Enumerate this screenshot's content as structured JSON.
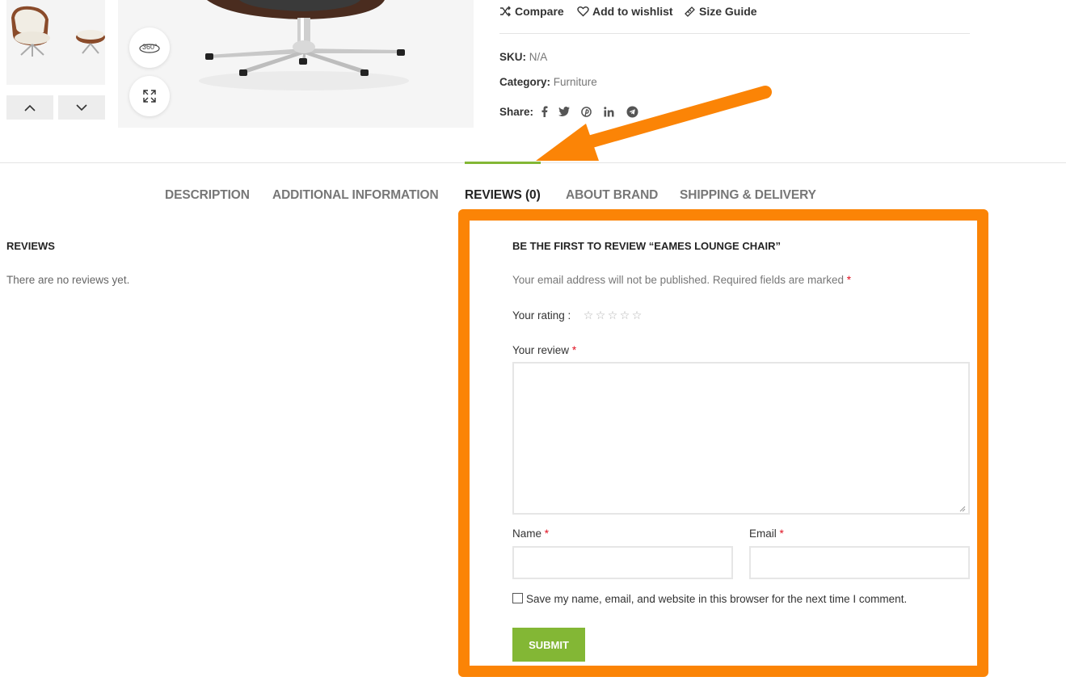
{
  "product_actions": {
    "compare": "Compare",
    "wishlist": "Add to wishlist",
    "size_guide": "Size Guide"
  },
  "meta": {
    "sku_label": "SKU:",
    "sku_value": "N/A",
    "category_label": "Category:",
    "category_value": "Furniture",
    "share_label": "Share:"
  },
  "share_icons": [
    "facebook-icon",
    "twitter-icon",
    "pinterest-icon",
    "linkedin-icon",
    "telegram-icon"
  ],
  "tabs": [
    {
      "label": "DESCRIPTION"
    },
    {
      "label": "ADDITIONAL INFORMATION"
    },
    {
      "label": "REVIEWS (0)",
      "active": true
    },
    {
      "label": "ABOUT BRAND"
    },
    {
      "label": "SHIPPING & DELIVERY"
    }
  ],
  "reviews": {
    "title": "REVIEWS",
    "empty_text": "There are no reviews yet."
  },
  "review_form": {
    "title": "BE THE FIRST TO REVIEW “EAMES LOUNGE CHAIR”",
    "notes": "Your email address will not be published. Required fields are marked",
    "required_marker": "*",
    "rating_label": "Your rating :",
    "rating_value": 0,
    "rating_max": 5,
    "review_label": "Your review",
    "name_label": "Name",
    "email_label": "Email",
    "name_value": "",
    "email_value": "",
    "review_value": "",
    "save_info_label": "Save my name, email, and website in this browser for the next time I comment.",
    "submit_label": "SUBMIT"
  },
  "colors": {
    "accent_green": "#83b735",
    "highlight_orange": "#fb8406",
    "required_red": "#e01020"
  }
}
